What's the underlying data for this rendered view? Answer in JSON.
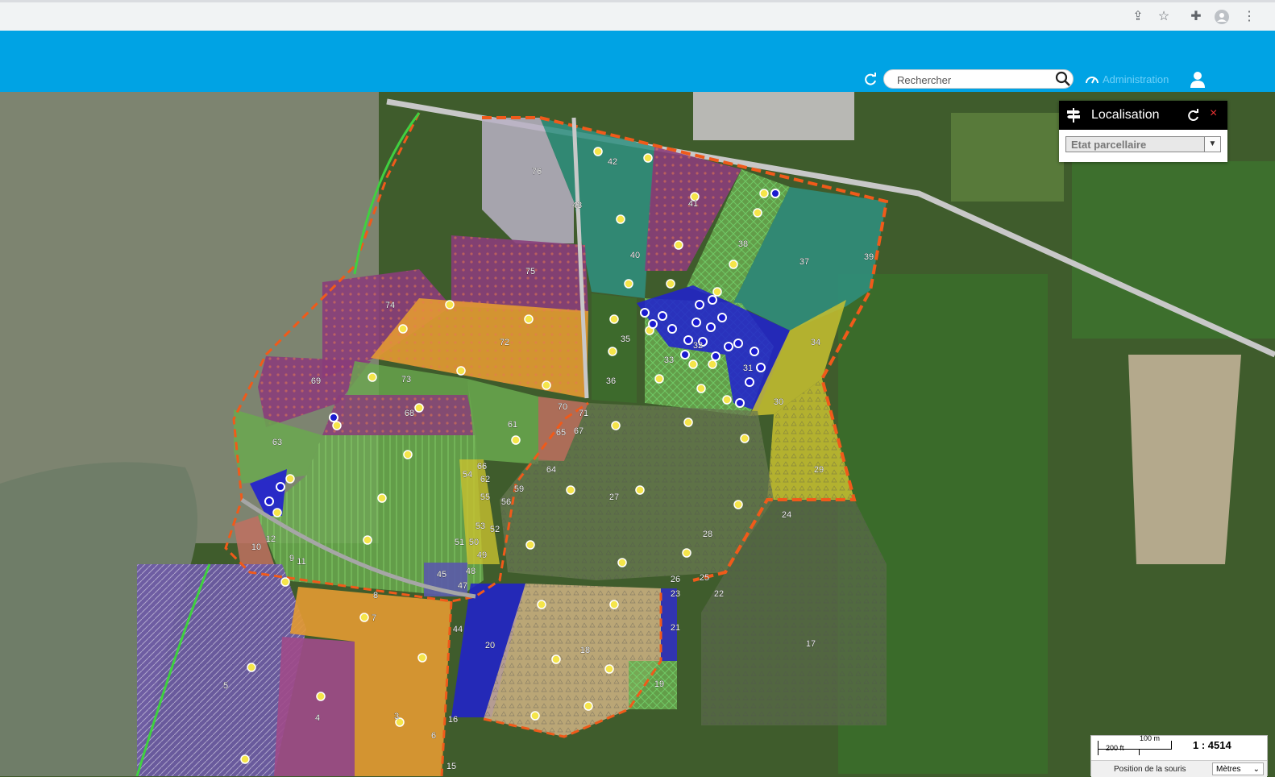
{
  "browser": {
    "icons": [
      "share-icon",
      "star-icon",
      "extensions-icon",
      "profile-icon",
      "menu-icon"
    ]
  },
  "header": {
    "search_placeholder": "Rechercher",
    "admin_label": "Administration",
    "accent": "#00a3e4"
  },
  "panel": {
    "title": "Localisation",
    "close": "×",
    "select_value": "Etat parcellaire"
  },
  "scale": {
    "metric": "100 m",
    "imperial": "200 ft",
    "ratio": "1 : 4514",
    "position_label": "Position de la souris",
    "unit": "Mètres"
  },
  "parcels": [
    "76",
    "42",
    "43",
    "41",
    "38",
    "37",
    "39",
    "40",
    "75",
    "74",
    "72",
    "35",
    "36",
    "33",
    "32",
    "31",
    "34",
    "30",
    "73",
    "69",
    "68",
    "70",
    "71",
    "65",
    "67",
    "61",
    "63",
    "64",
    "66",
    "54",
    "62",
    "55",
    "56",
    "59",
    "27",
    "29",
    "24",
    "28",
    "53",
    "52",
    "51",
    "50",
    "49",
    "48",
    "45",
    "47",
    "26",
    "25",
    "23",
    "22",
    "10",
    "12",
    "9",
    "11",
    "8",
    "7",
    "44",
    "20",
    "21",
    "18",
    "17",
    "19",
    "5",
    "4",
    "3",
    "16",
    "6",
    "15"
  ],
  "legend_colors": {
    "violet": "#8a3d7a",
    "orange": "#e39a32",
    "green": "#6aa84f",
    "teal": "#2f8f80",
    "blue": "#2020d0",
    "yellow": "#c8c030",
    "beige": "#d9b98a",
    "boundary": "#f05a1a"
  }
}
